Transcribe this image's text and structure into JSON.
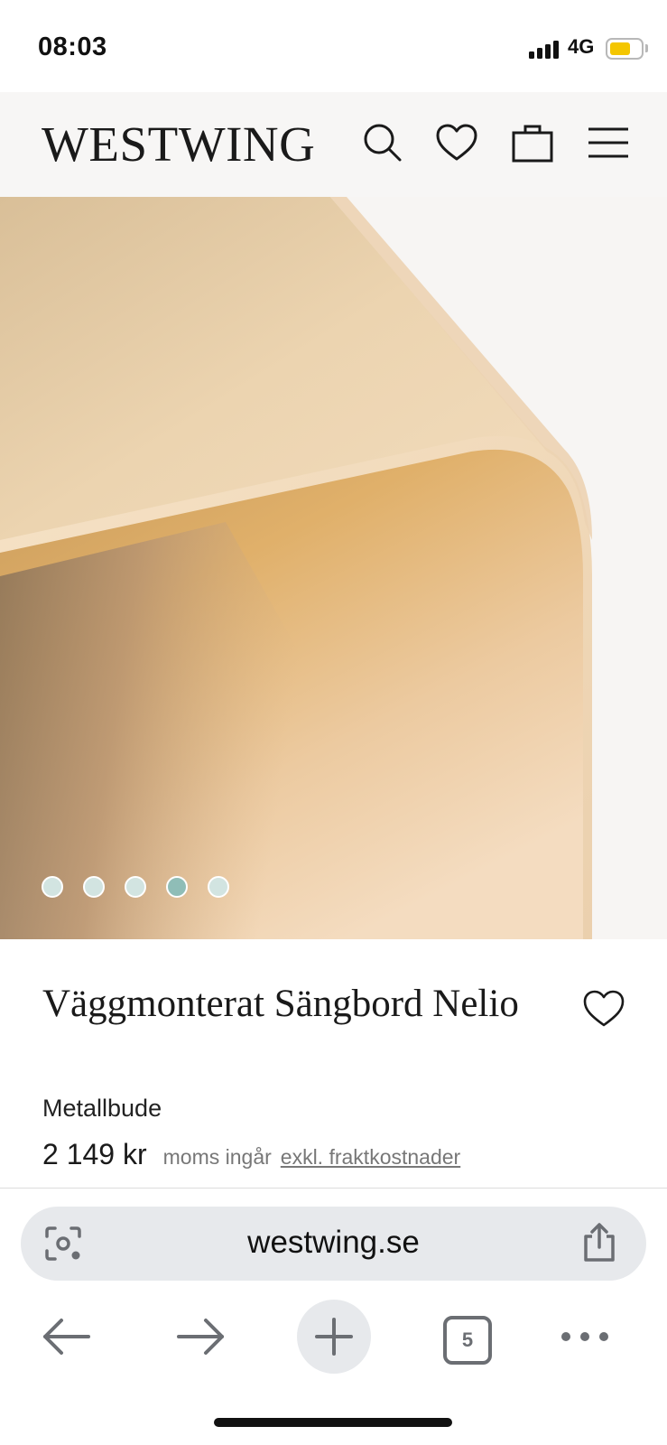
{
  "status_bar": {
    "time": "08:03",
    "network": "4G",
    "battery_color": "#f4c600",
    "icons": [
      "cellular-signal-icon",
      "battery-icon"
    ]
  },
  "header": {
    "logo": "WESTWING",
    "icons": [
      "search-icon",
      "heart-icon",
      "shopping-bag-icon",
      "menu-icon"
    ]
  },
  "gallery": {
    "image": "product-photo-wall-shelf-closeup",
    "slide_count": 5,
    "active_index": 3,
    "dot_color": "#d2e4e1",
    "active_dot_color": "#8fbdb7"
  },
  "product": {
    "title": "Väggmonterat Sängbord Nelio",
    "brand": "Metallbude",
    "price": "2 149 kr",
    "vat_note": "moms ingår",
    "shipping_note": "exkl. fraktkostnader",
    "favorite_icon": "heart-outline-icon"
  },
  "browser": {
    "url": "westwing.se",
    "tab_count": "5",
    "icons": [
      "page-tools-icon",
      "share-icon",
      "back-arrow-icon",
      "forward-arrow-icon",
      "plus-icon",
      "tabs-icon",
      "more-icon"
    ]
  }
}
